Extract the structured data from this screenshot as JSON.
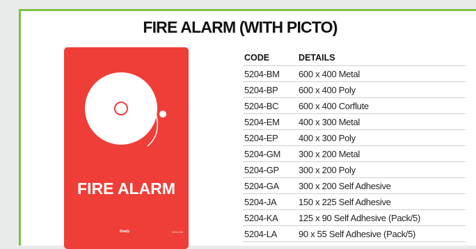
{
  "title": "FIRE ALARM (WITH PICTO)",
  "colors": {
    "accent_border": "#7bc143",
    "sign_red": "#ee3e37"
  },
  "sign": {
    "icon": "fire-alarm-bell-icon",
    "label": "FIRE ALARM",
    "brand_mark": "Brady",
    "code": "5204-BM"
  },
  "table": {
    "headers": [
      "CODE",
      "DETAILS"
    ],
    "rows": [
      [
        "5204-BM",
        "600 x 400 Metal"
      ],
      [
        "5204-BP",
        "600 x 400 Poly"
      ],
      [
        "5204-BC",
        "600 x 400 Corflute"
      ],
      [
        "5204-EM",
        "400 x 300 Metal"
      ],
      [
        "5204-EP",
        "400 x 300 Poly"
      ],
      [
        "5204-GM",
        "300 x 200 Metal"
      ],
      [
        "5204-GP",
        "300 x 200 Poly"
      ],
      [
        "5204-GA",
        "300 x 200 Self Adhesive"
      ],
      [
        "5204-JA",
        "150 x 225 Self Adhesive"
      ],
      [
        "5204-KA",
        "125 x 90 Self Adhesive (Pack/5)"
      ],
      [
        "5204-LA",
        "90 x 55 Self Adhesive (Pack/5)"
      ]
    ]
  }
}
